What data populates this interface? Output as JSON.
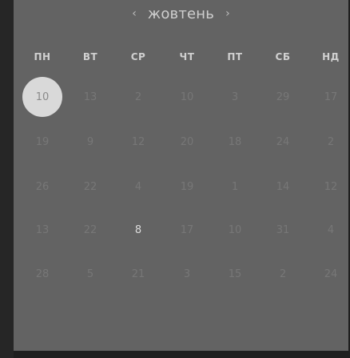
{
  "calendar": {
    "month_label": "жовтень",
    "prev_icon": "chevron-left-icon",
    "next_icon": "chevron-right-icon",
    "weekdays": [
      "ПН",
      "ВТ",
      "СР",
      "ЧТ",
      "ПТ",
      "СБ",
      "НД"
    ],
    "weeks": [
      [
        "10",
        "13",
        "2",
        "10",
        "3",
        "29",
        "17"
      ],
      [
        "19",
        "9",
        "12",
        "20",
        "18",
        "24",
        "2"
      ],
      [
        "26",
        "22",
        "4",
        "19",
        "1",
        "14",
        "12"
      ],
      [
        "13",
        "22",
        "8",
        "17",
        "10",
        "31",
        "4"
      ],
      [
        "28",
        "5",
        "21",
        "3",
        "15",
        "2",
        "24"
      ]
    ],
    "selected_day": "10",
    "current_day": "8"
  }
}
